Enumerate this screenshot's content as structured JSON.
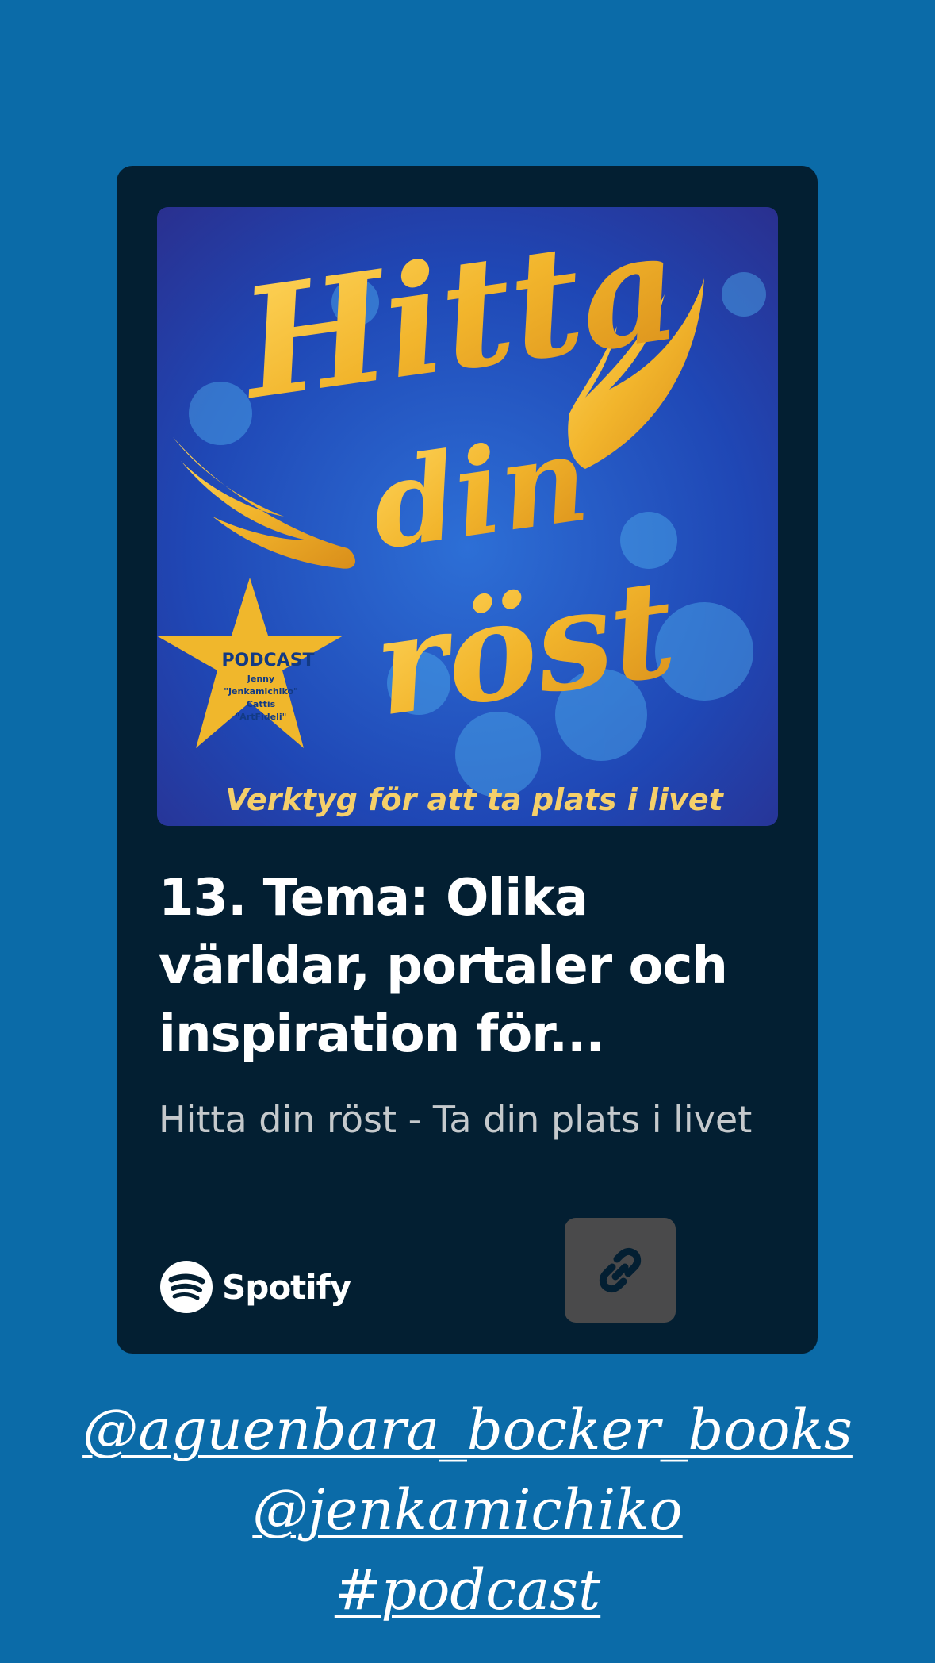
{
  "cover": {
    "title_line1": "Hitta",
    "title_line2": "din",
    "title_line3": "röst",
    "badge_heading": "PODCAST",
    "badge_lines": [
      "Jenny",
      "\"Jenkamichiko\"",
      "Cattis",
      "\"ArtFideli\""
    ],
    "tagline": "Verktyg för att ta plats i livet"
  },
  "episode": {
    "title": "13. Tema: Olika världar, portaler och inspiration för...",
    "show": "Hitta din röst - Ta din plats i livet"
  },
  "spotify": {
    "wordmark": "Spotify"
  },
  "link_button": {
    "icon": "link-icon"
  },
  "tags": [
    "@aguenbara_bocker_books",
    "@jenkamichiko",
    "#podcast"
  ],
  "colors": {
    "background": "#0b6ba8",
    "card": "#031f32",
    "gold": "#f2c13c",
    "link_button": "#4a4a4b"
  }
}
